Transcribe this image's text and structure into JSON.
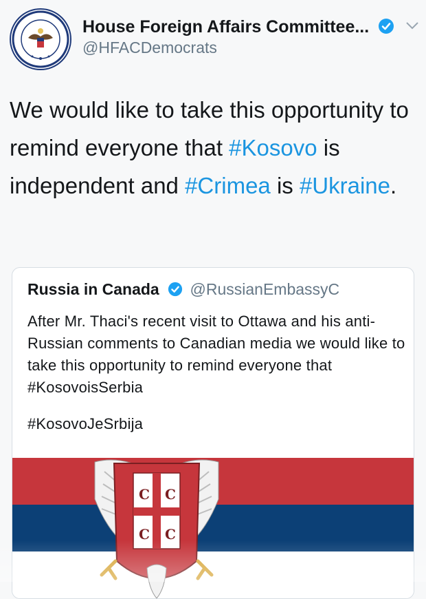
{
  "tweet": {
    "author": {
      "name": "House Foreign Affairs Committee...",
      "handle": "@HFACDemocrats",
      "avatar_icon": "hfac-seal-icon"
    },
    "text_parts": [
      "We would like to take this opportunity to remind everyone that ",
      "#Kosovo",
      " is independent and ",
      "#Crimea",
      " is ",
      "#Ukraine",
      "."
    ]
  },
  "quote": {
    "name": "Russia in Canada",
    "handle": "@RussianEmbassyC",
    "text": "After Mr. Thaci's recent visit to Ottawa and his anti-Russian comments to Canadian media we would like to take this opportunity to remind everyone that #KosovoisSerbia",
    "hashtag": "#KosovoJeSrbija",
    "media_icon": "serbian-flag-image"
  },
  "colors": {
    "link": "#1b95e0",
    "verified": "#1da1f2",
    "flag_red": "#c6363c",
    "flag_blue": "#0c4076",
    "flag_white": "#ffffff"
  }
}
